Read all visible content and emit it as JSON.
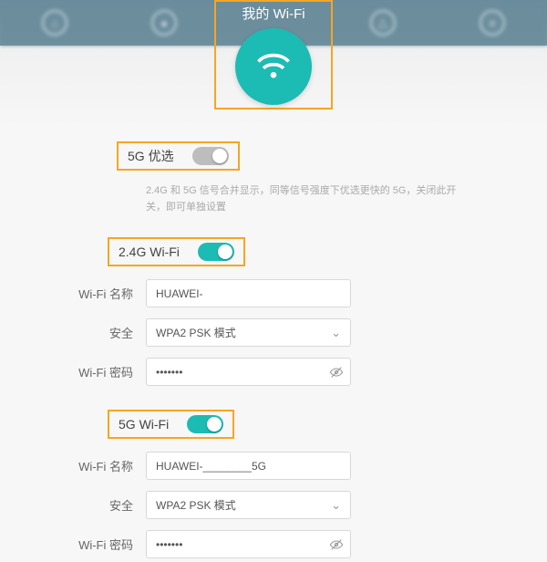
{
  "header": {
    "title": "我的 Wi-Fi"
  },
  "prefer5g": {
    "label": "5G 优选",
    "hint": "2.4G 和 5G 信号合并显示，同等信号强度下优选更快的 5G，关闭此开关，即可单独设置"
  },
  "wifi24": {
    "section": "2.4G Wi-Fi",
    "name_label": "Wi-Fi 名称",
    "name_value": "HUAWEI-",
    "security_label": "安全",
    "security_value": "WPA2 PSK 模式",
    "password_label": "Wi-Fi 密码",
    "password_value": "•••••••"
  },
  "wifi5g": {
    "section": "5G Wi-Fi",
    "name_label": "Wi-Fi 名称",
    "name_value": "HUAWEI-________5G",
    "security_label": "安全",
    "security_value": "WPA2 PSK 模式",
    "password_label": "Wi-Fi 密码",
    "password_value": "•••••••"
  }
}
